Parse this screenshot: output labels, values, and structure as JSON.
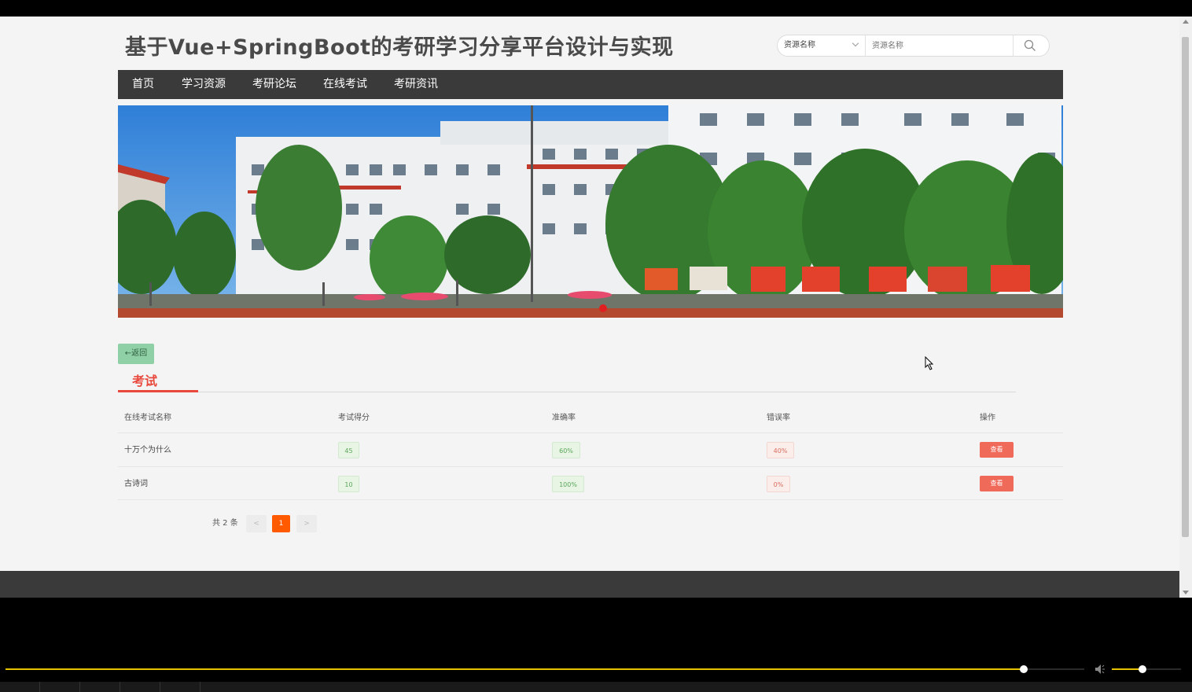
{
  "site": {
    "title": "基于Vue+SpringBoot的考研学习分享平台设计与实现"
  },
  "search": {
    "select_value": "资源名称",
    "placeholder": "资源名称",
    "icon": "search-icon"
  },
  "nav": {
    "items": [
      "首页",
      "学习资源",
      "考研论坛",
      "在线考试",
      "考研资讯"
    ]
  },
  "banner": {
    "carousel_slide_count_visible": 1
  },
  "page": {
    "back_label": "←返回",
    "section_title": "考试"
  },
  "table": {
    "headers": [
      "在线考试名称",
      "考试得分",
      "准确率",
      "错误率",
      "操作"
    ],
    "rows": [
      {
        "name": "十万个为什么",
        "score": "45",
        "accuracy": "60%",
        "error_rate": "40%",
        "action": "查看"
      },
      {
        "name": "古诗词",
        "score": "10",
        "accuracy": "100%",
        "error_rate": "0%",
        "action": "查看"
      }
    ]
  },
  "pagination": {
    "total_text": "共 2 条",
    "prev": "<",
    "current": "1",
    "next": ">"
  },
  "player": {
    "progress_fraction": 0.944,
    "volume_fraction": 0.44,
    "accent_color": "#e6c200"
  },
  "colors": {
    "nav_bg": "#3a3a3a",
    "accent_red": "#e8493c",
    "page_active": "#ff5a00",
    "back_button": "#8fd0a6"
  }
}
